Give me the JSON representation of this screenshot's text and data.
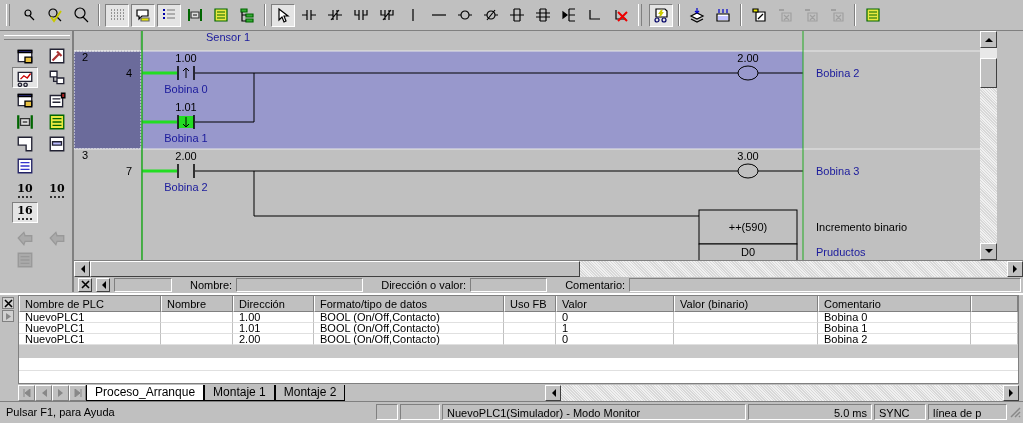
{
  "toolbar_bands": [
    [
      [
        {
          "kind": "zoom-small",
          "pressed": false,
          "disabled": false
        },
        {
          "kind": "zoom-check",
          "pressed": false,
          "disabled": false
        },
        {
          "kind": "zoom",
          "pressed": false,
          "disabled": false
        }
      ],
      [
        {
          "kind": "grid",
          "pressed": true,
          "disabled": false
        },
        {
          "kind": "comment",
          "pressed": true,
          "disabled": false
        },
        {
          "kind": "list",
          "pressed": true,
          "disabled": false
        },
        {
          "kind": "crossref",
          "pressed": false,
          "disabled": false
        },
        {
          "kind": "memory",
          "pressed": false,
          "disabled": false
        },
        {
          "kind": "tree",
          "pressed": false,
          "disabled": false
        }
      ],
      [
        {
          "kind": "select",
          "pressed": true,
          "disabled": false
        },
        {
          "kind": "contact-no",
          "pressed": false,
          "disabled": false
        },
        {
          "kind": "contact-nc",
          "pressed": false,
          "disabled": false
        },
        {
          "kind": "or-no",
          "pressed": false,
          "disabled": false
        },
        {
          "kind": "or-nc",
          "pressed": false,
          "disabled": false
        },
        {
          "kind": "vline",
          "pressed": false,
          "disabled": false
        },
        {
          "kind": "hline",
          "pressed": false,
          "disabled": false
        },
        {
          "kind": "coil",
          "pressed": false,
          "disabled": false
        },
        {
          "kind": "coil-nc",
          "pressed": false,
          "disabled": false
        },
        {
          "kind": "instr",
          "pressed": false,
          "disabled": false
        },
        {
          "kind": "instr2",
          "pressed": false,
          "disabled": false
        },
        {
          "kind": "instr3",
          "pressed": false,
          "disabled": false
        },
        {
          "kind": "corner",
          "pressed": false,
          "disabled": false
        },
        {
          "kind": "delete",
          "pressed": false,
          "disabled": false
        }
      ]
    ],
    [
      [
        {
          "kind": "monitor",
          "pressed": true,
          "disabled": false
        }
      ],
      [
        {
          "kind": "download",
          "pressed": false,
          "disabled": false
        },
        {
          "kind": "upload",
          "pressed": false,
          "disabled": false
        }
      ],
      [
        {
          "kind": "edit",
          "pressed": false,
          "disabled": false
        },
        {
          "kind": "transfer",
          "pressed": false,
          "disabled": true
        },
        {
          "kind": "transfer",
          "pressed": false,
          "disabled": true
        },
        {
          "kind": "transfer",
          "pressed": false,
          "disabled": true
        }
      ],
      [
        {
          "kind": "memory",
          "pressed": false,
          "disabled": false
        }
      ]
    ]
  ],
  "sidebar_groups": [
    [
      {
        "kind": "window",
        "pressed": false,
        "disabled": false
      },
      {
        "kind": "hammer",
        "pressed": false,
        "disabled": false
      },
      {
        "kind": "ladder",
        "pressed": true,
        "disabled": false
      },
      {
        "kind": "blocks",
        "pressed": false,
        "disabled": false
      },
      {
        "kind": "window",
        "pressed": false,
        "disabled": false
      },
      {
        "kind": "properties",
        "pressed": false,
        "disabled": false
      },
      {
        "kind": "crossref",
        "pressed": false,
        "disabled": false
      },
      {
        "kind": "memory",
        "pressed": false,
        "disabled": false
      },
      {
        "kind": "io",
        "pressed": false,
        "disabled": false
      },
      {
        "kind": "panel",
        "pressed": false,
        "disabled": false
      },
      {
        "kind": "binary",
        "pressed": false,
        "disabled": false
      }
    ],
    [
      {
        "kind": "counter",
        "label": "10",
        "pressed": false,
        "disabled": false
      },
      {
        "kind": "counter",
        "label": "10",
        "pressed": false,
        "disabled": false
      },
      {
        "kind": "counter",
        "label": "16",
        "pressed": true,
        "disabled": false
      }
    ],
    [
      {
        "kind": "arrow",
        "pressed": false,
        "disabled": true
      },
      {
        "kind": "arrow",
        "pressed": false,
        "disabled": true
      },
      {
        "kind": "binary",
        "pressed": false,
        "disabled": true
      }
    ]
  ],
  "ladder": {
    "top_comment": "Sensor 1",
    "rungs": [
      {
        "number": "2",
        "step": "4",
        "selected": true,
        "contacts": [
          {
            "kind": "rising",
            "address": "1.00",
            "comment": "Bobina 0",
            "powered": true,
            "on": false
          },
          {
            "kind": "falling",
            "address": "1.01",
            "comment": "Bobina 1",
            "powered": true,
            "on": true
          }
        ],
        "coil": {
          "address": "2.00",
          "comment": "Bobina 2"
        }
      },
      {
        "number": "3",
        "step": "7",
        "selected": false,
        "contacts": [
          {
            "kind": "open",
            "address": "2.00",
            "comment": "Bobina 2",
            "powered": true,
            "on": false
          }
        ],
        "coil": {
          "address": "3.00",
          "comment": "Bobina 3"
        },
        "instruction": {
          "name": "++(590)",
          "comment": "Incremento binario",
          "operand": "D0",
          "operand_comment": "Pruductos"
        }
      }
    ]
  },
  "fields": [
    {
      "label": "Nombre:"
    },
    {
      "label": "Dirección o valor:"
    },
    {
      "label": "Comentario:"
    }
  ],
  "table": {
    "columns": [
      "Nombre de PLC",
      "Nombre",
      "Dirección",
      "Formato/tipo de datos",
      "Uso FB",
      "Valor",
      "Valor (binario)",
      "Comentario"
    ],
    "rows": [
      [
        "NuevoPLC1",
        "",
        "1.00",
        "BOOL (On/Off,Contacto)",
        "",
        "0",
        "",
        "Bobina 0"
      ],
      [
        "NuevoPLC1",
        "",
        "1.01",
        "BOOL (On/Off,Contacto)",
        "",
        "1",
        "",
        "Bobina 1"
      ],
      [
        "NuevoPLC1",
        "",
        "2.00",
        "BOOL (On/Off,Contacto)",
        "",
        "0",
        "",
        "Bobina 2"
      ]
    ]
  },
  "sheet_tabs": [
    {
      "label": "Proceso_Arranque",
      "selected": true
    },
    {
      "label": "Montaje 1",
      "selected": false
    },
    {
      "label": "Montaje 2",
      "selected": false
    }
  ],
  "status_bar": {
    "help": "Pulsar F1, para Ayuda",
    "connection": "NuevoPLC1(Simulador) - Modo Monitor",
    "cycle_time": "5.0 ms",
    "sync": "SYNC",
    "position": "línea de p"
  }
}
